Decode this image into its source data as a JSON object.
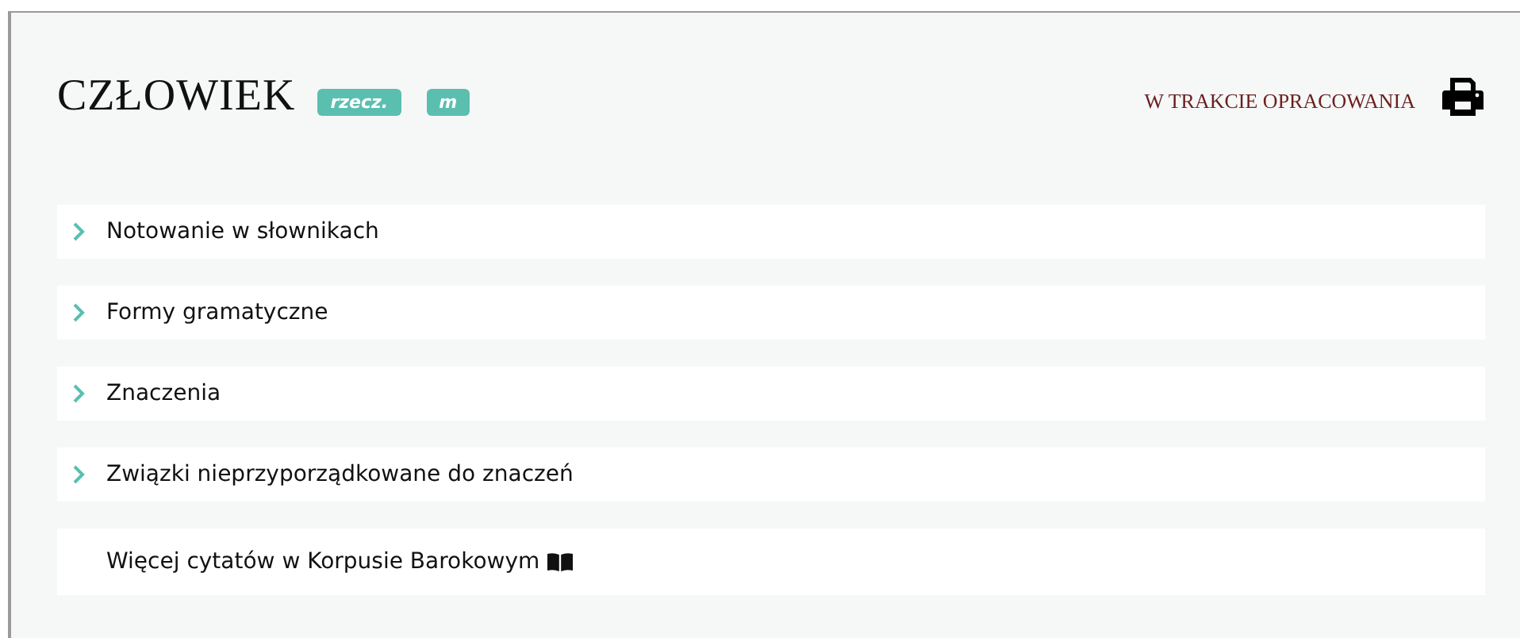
{
  "header": {
    "title": "CZŁOWIEK",
    "tags": [
      "rzecz.",
      "m"
    ],
    "status": "W TRAKCIE OPRACOWANIA"
  },
  "sections": [
    {
      "kind": "expandable",
      "label": "Notowanie w słownikach",
      "expanded": false
    },
    {
      "kind": "expandable",
      "label": "Formy gramatyczne",
      "expanded": false
    },
    {
      "kind": "expandable",
      "label": "Znaczenia",
      "expanded": false
    },
    {
      "kind": "expandable",
      "label": "Związki nieprzyporządkowane do znaczeń",
      "expanded": false
    },
    {
      "kind": "link",
      "label": "Więcej cytatów w Korpusie Barokowym"
    }
  ]
}
